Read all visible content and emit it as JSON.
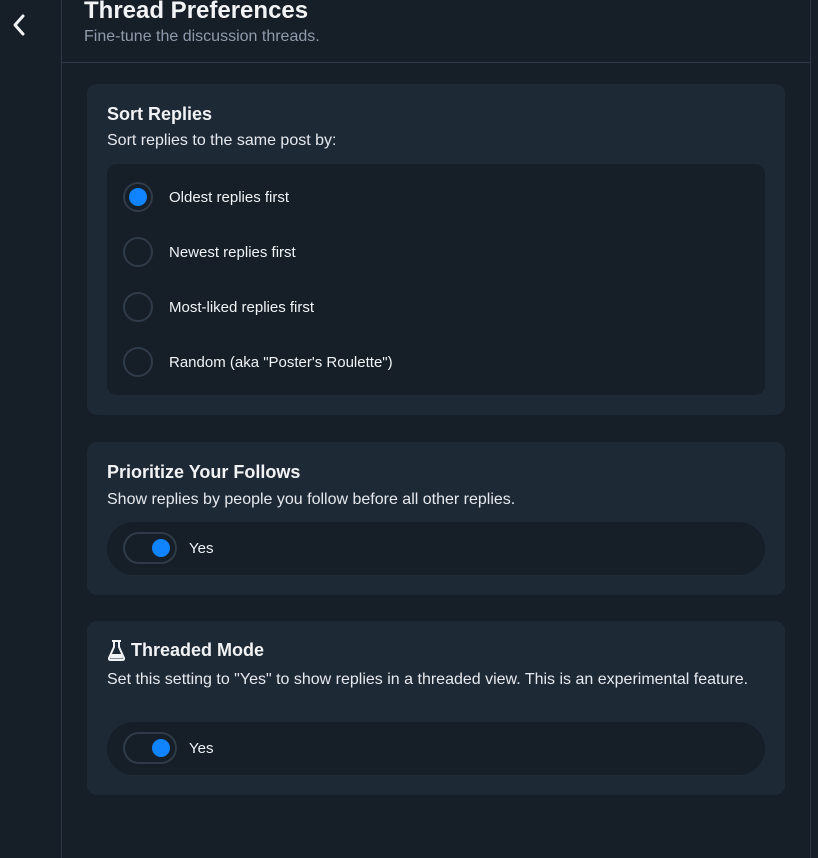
{
  "header": {
    "title": "Thread Preferences",
    "subtitle": "Fine-tune the discussion threads."
  },
  "sort_replies": {
    "title": "Sort Replies",
    "description": "Sort replies to the same post by:",
    "options": [
      {
        "label": "Oldest replies first",
        "selected": true
      },
      {
        "label": "Newest replies first",
        "selected": false
      },
      {
        "label": "Most-liked replies first",
        "selected": false
      },
      {
        "label": "Random (aka \"Poster's Roulette\")",
        "selected": false
      }
    ]
  },
  "prioritize_follows": {
    "title": "Prioritize Your Follows",
    "description": "Show replies by people you follow before all other replies.",
    "toggle_label": "Yes",
    "enabled": true
  },
  "threaded_mode": {
    "title": "Threaded Mode",
    "description": "Set this setting to \"Yes\" to show replies in a threaded view. This is an experimental feature.",
    "toggle_label": "Yes",
    "enabled": true,
    "icon": "flask-icon"
  },
  "colors": {
    "accent": "#1083fe",
    "background": "#161e27",
    "card": "#1e2936",
    "border": "#2e3a47",
    "muted_text": "#8f9bab"
  }
}
